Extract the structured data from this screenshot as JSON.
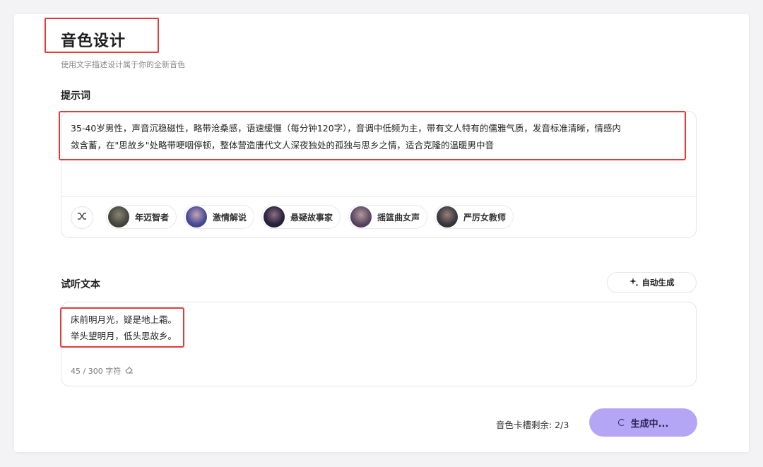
{
  "header": {
    "title": "音色设计",
    "subtitle": "使用文字描述设计属于你的全新音色"
  },
  "prompt": {
    "label": "提示词",
    "text_line1": "35-40岁男性，声音沉稳磁性，略带沧桑感，语速缓慢（每分钟120字），音调中低频为主，带有文人特有的儒雅气质，发音标准清晰，情感内",
    "text_line2": "敛含蓄，在\"思故乡\"处略带哽咽停顿，整体营造唐代文人深夜独处的孤独与思乡之情，适合克隆的温暖男中音"
  },
  "presets": {
    "shuffle_icon": "shuffle-icon",
    "items": [
      {
        "label": "年迈智者",
        "avatar_color": "#4a4a42"
      },
      {
        "label": "激情解说",
        "avatar_color": "#4b4f9a"
      },
      {
        "label": "悬疑故事家",
        "avatar_color": "#2a2440"
      },
      {
        "label": "摇篮曲女声",
        "avatar_color": "#5e4a66"
      },
      {
        "label": "严厉女教师",
        "avatar_color": "#3a3b40"
      }
    ]
  },
  "sample": {
    "label": "试听文本",
    "auto_label": "自动生成",
    "line1": "床前明月光，疑是地上霜。",
    "line2": "举头望明月，低头思故乡。",
    "count": "45 / 300 字符"
  },
  "footer": {
    "slots_text": "音色卡槽剩余: 2/3",
    "generate_label": "生成中..."
  },
  "colors": {
    "highlight": "#e23b3b",
    "primary_button": "#b4a6f5"
  }
}
